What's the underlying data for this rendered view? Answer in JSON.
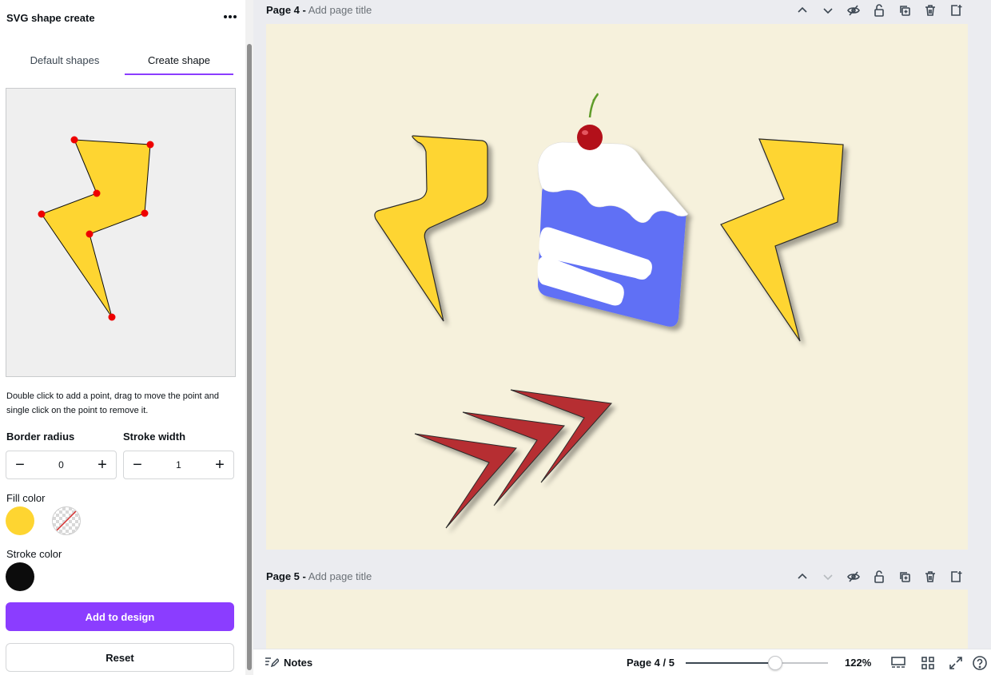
{
  "panel": {
    "title": "SVG shape create",
    "tabs": [
      {
        "label": "Default shapes",
        "active": false
      },
      {
        "label": "Create shape",
        "active": true
      }
    ],
    "help_text": "Double click to add a point, drag to move the point and single click on the point to remove it.",
    "border_radius": {
      "label": "Border radius",
      "value": "0"
    },
    "stroke_width": {
      "label": "Stroke width",
      "value": "1"
    },
    "fill_color": {
      "label": "Fill color",
      "value": "#fed531"
    },
    "stroke_color": {
      "label": "Stroke color",
      "value": "#0c0c0c"
    },
    "add_button": "Add to design",
    "reset_button": "Reset"
  },
  "pages": [
    {
      "number": "Page 4 -",
      "title_placeholder": "Add page title"
    },
    {
      "number": "Page 5 -",
      "title_placeholder": "Add page title"
    }
  ],
  "bottom_bar": {
    "notes_label": "Notes",
    "page_count": "Page 4 / 5",
    "zoom": "122%",
    "zoom_fraction": 0.63
  },
  "colors": {
    "accent": "#8b3dff",
    "canvas_bg": "#f6f1dc",
    "bolt_yellow": "#fed531",
    "cake_blue": "#6170f5",
    "chevron_red": "#b62e31"
  }
}
